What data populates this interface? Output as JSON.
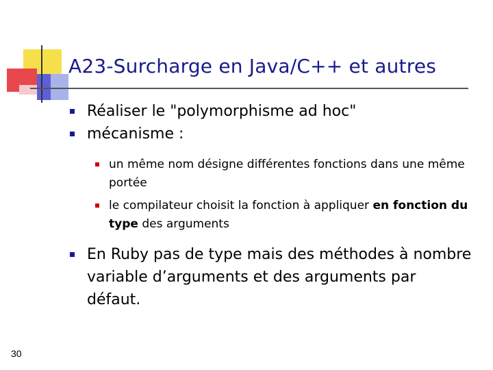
{
  "slide": {
    "title": "A23-Surcharge en Java/C++ et autres",
    "page_number": "30",
    "bullets": [
      {
        "text": "Réaliser le \"polymorphisme ad hoc\""
      },
      {
        "text": "mécanisme :"
      },
      {
        "text": "En Ruby pas de type mais des méthodes à nombre variable d’arguments et des arguments par défaut."
      }
    ],
    "sub_bullets": [
      {
        "text": "un même nom désigne différentes fonctions dans une même portée"
      },
      {
        "text_before": "le compilateur choisit la fonction à appliquer ",
        "bold": "en fonction du type",
        "text_after": " des arguments"
      }
    ]
  },
  "colors": {
    "title": "#1a1a8c",
    "bullet_level1": "#1a1a8c",
    "bullet_level2": "#cc0000",
    "deco_yellow": "#f5e04a",
    "deco_red": "#e8474d",
    "deco_blue": "#5d5fd8",
    "deco_lightblue": "#a9b3ea"
  }
}
